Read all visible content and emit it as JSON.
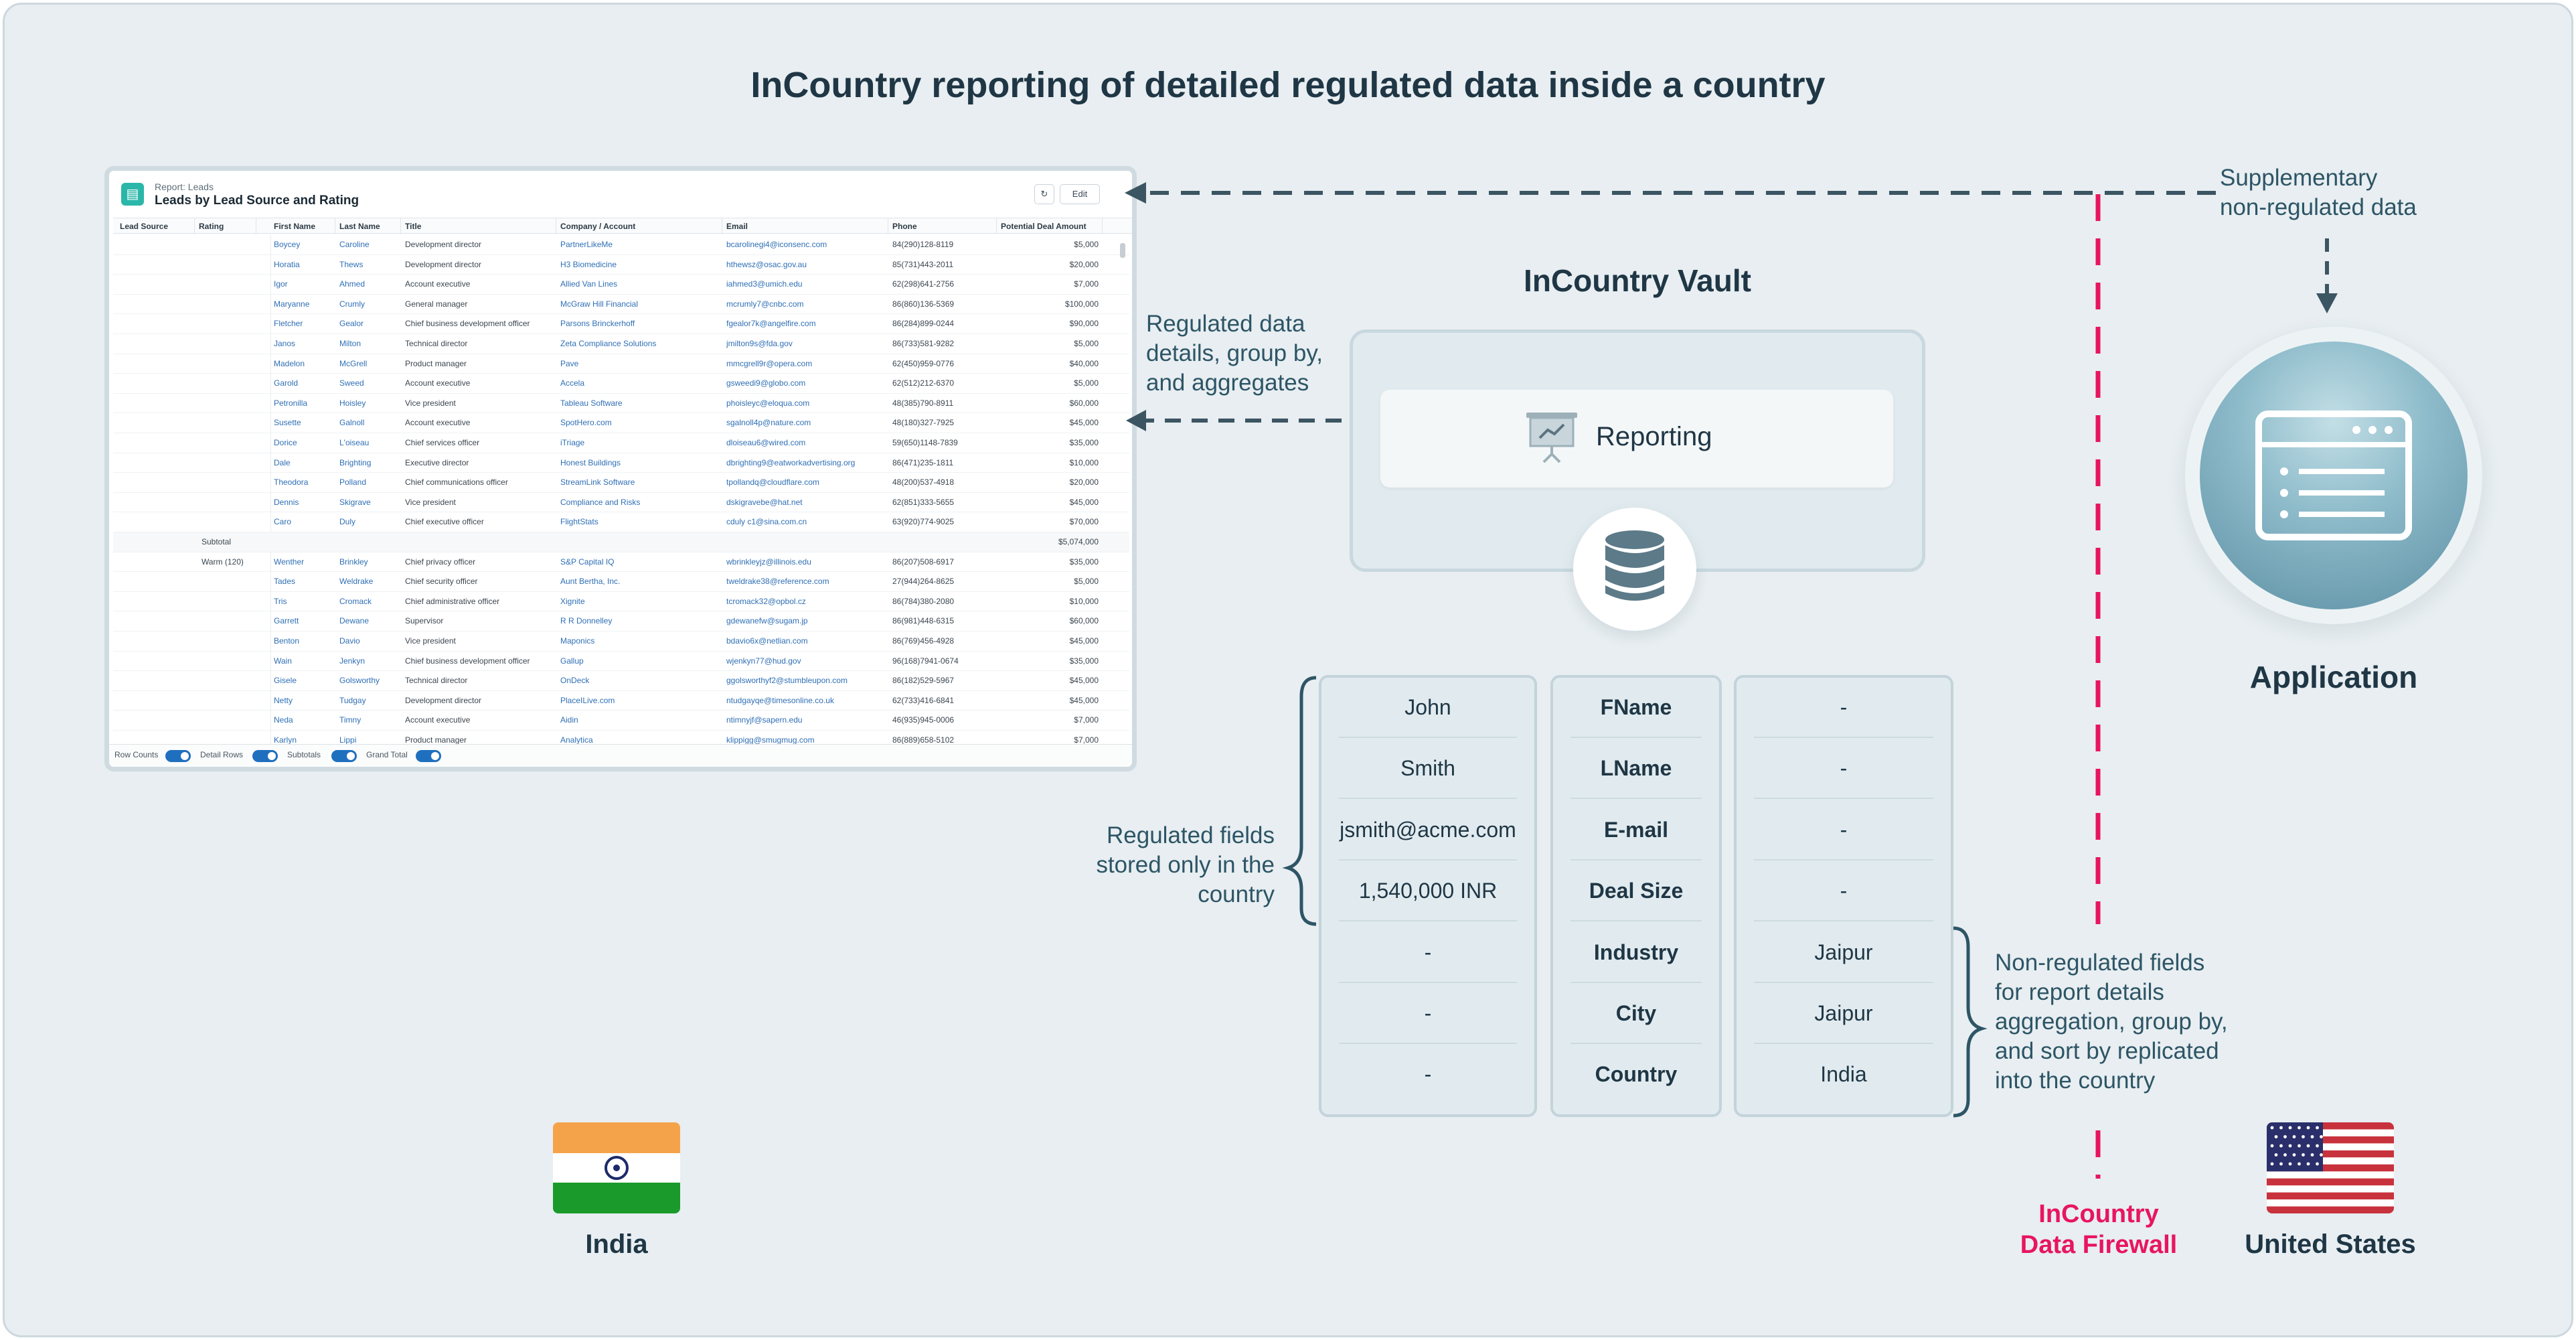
{
  "title": "InCountry reporting of detailed regulated data inside a country",
  "report": {
    "subtitle": "Report: Leads",
    "title": "Leads by Lead Source and Rating",
    "edit_label": "Edit",
    "refresh_icon": "refresh-icon",
    "columns": [
      "Lead Source",
      "Rating",
      "First Name",
      "Last Name",
      "Title",
      "Company / Account",
      "Email",
      "Phone",
      "Potential Deal Amount"
    ],
    "rows": [
      {
        "first": "Boycey",
        "last": "Caroline",
        "title": "Development director",
        "company": "PartnerLikeMe",
        "email": "bcarolinegi4@iconsenc.com",
        "phone": "84(290)128-8119",
        "amount": "$5,000"
      },
      {
        "first": "Horatia",
        "last": "Thews",
        "title": "Development director",
        "company": "H3 Biomedicine",
        "email": "hthewsz@osac.gov.au",
        "phone": "85(731)443-2011",
        "amount": "$20,000"
      },
      {
        "first": "Igor",
        "last": "Ahmed",
        "title": "Account executive",
        "company": "Allied Van Lines",
        "email": "iahmed3@umich.edu",
        "phone": "62(298)641-2756",
        "amount": "$7,000"
      },
      {
        "first": "Maryanne",
        "last": "Crumly",
        "title": "General manager",
        "company": "McGraw Hill Financial",
        "email": "mcrumly7@cnbc.com",
        "phone": "86(860)136-5369",
        "amount": "$100,000"
      },
      {
        "first": "Fletcher",
        "last": "Gealor",
        "title": "Chief business development officer",
        "company": "Parsons Brinckerhoff",
        "email": "fgealor7k@angelfire.com",
        "phone": "86(284)899-0244",
        "amount": "$90,000"
      },
      {
        "first": "Janos",
        "last": "Milton",
        "title": "Technical director",
        "company": "Zeta Compliance Solutions",
        "email": "jmilton9s@fda.gov",
        "phone": "86(733)581-9282",
        "amount": "$5,000"
      },
      {
        "first": "Madelon",
        "last": "McGrell",
        "title": "Product manager",
        "company": "Pave",
        "email": "mmcgrell9r@opera.com",
        "phone": "62(450)959-0776",
        "amount": "$40,000"
      },
      {
        "first": "Garold",
        "last": "Sweed",
        "title": "Account executive",
        "company": "Accela",
        "email": "gsweedi9@globo.com",
        "phone": "62(512)212-6370",
        "amount": "$5,000"
      },
      {
        "first": "Petronilla",
        "last": "Hoisley",
        "title": "Vice president",
        "company": "Tableau Software",
        "email": "phoisleyc@eloqua.com",
        "phone": "48(385)790-8911",
        "amount": "$60,000"
      },
      {
        "first": "Susette",
        "last": "Galnoll",
        "title": "Account executive",
        "company": "SpotHero.com",
        "email": "sgalnoll4p@nature.com",
        "phone": "48(180)327-7925",
        "amount": "$45,000"
      },
      {
        "first": "Dorice",
        "last": "L'oiseau",
        "title": "Chief services officer",
        "company": "iTriage",
        "email": "dloiseau6@wired.com",
        "phone": "59(650)1148-7839",
        "amount": "$35,000"
      },
      {
        "first": "Dale",
        "last": "Brighting",
        "title": "Executive director",
        "company": "Honest Buildings",
        "email": "dbrighting9@eatworkadvertising.org",
        "phone": "86(471)235-1811",
        "amount": "$10,000"
      },
      {
        "first": "Theodora",
        "last": "Polland",
        "title": "Chief communications officer",
        "company": "StreamLink Software",
        "email": "tpollandq@cloudflare.com",
        "phone": "48(200)537-4918",
        "amount": "$20,000"
      },
      {
        "first": "Dennis",
        "last": "Skigrave",
        "title": "Vice president",
        "company": "Compliance and Risks",
        "email": "dskigravebe@hat.net",
        "phone": "62(851)333-5655",
        "amount": "$45,000"
      },
      {
        "first": "Caro",
        "last": "Duly",
        "title": "Chief executive officer",
        "company": "FlightStats",
        "email": "cduly c1@sina.com.cn",
        "phone": "63(920)774-9025",
        "amount": "$70,000"
      },
      {
        "subtotal": "Subtotal",
        "amount": "$5,074,000"
      },
      {
        "group": "Warm (120)",
        "first": "Wenther",
        "last": "Brinkley",
        "title": "Chief privacy officer",
        "company": "S&P Capital IQ",
        "email": "wbrinkleyjz@illinois.edu",
        "phone": "86(207)508-6917",
        "amount": "$35,000"
      },
      {
        "first": "Tades",
        "last": "Weldrake",
        "title": "Chief security officer",
        "company": "Aunt Bertha, Inc.",
        "email": "tweldrake38@reference.com",
        "phone": "27(944)264-8625",
        "amount": "$5,000"
      },
      {
        "first": "Tris",
        "last": "Cromack",
        "title": "Chief administrative officer",
        "company": "Xignite",
        "email": "tcromack32@opbol.cz",
        "phone": "86(784)380-2080",
        "amount": "$10,000"
      },
      {
        "first": "Garrett",
        "last": "Dewane",
        "title": "Supervisor",
        "company": "R R Donnelley",
        "email": "gdewanefw@sugam.jp",
        "phone": "86(981)448-6315",
        "amount": "$60,000"
      },
      {
        "first": "Benton",
        "last": "Davio",
        "title": "Vice president",
        "company": "Maponics",
        "email": "bdavio6x@netlian.com",
        "phone": "86(769)456-4928",
        "amount": "$45,000"
      },
      {
        "first": "Wain",
        "last": "Jenkyn",
        "title": "Chief business development officer",
        "company": "Gallup",
        "email": "wjenkyn77@hud.gov",
        "phone": "96(168)7941-0674",
        "amount": "$35,000"
      },
      {
        "first": "Gisele",
        "last": "Golsworthy",
        "title": "Technical director",
        "company": "OnDeck",
        "email": "ggolsworthyf2@stumbleupon.com",
        "phone": "86(182)529-5967",
        "amount": "$45,000"
      },
      {
        "first": "Netty",
        "last": "Tudgay",
        "title": "Development director",
        "company": "PlaceILive.com",
        "email": "ntudgayqe@timesonline.co.uk",
        "phone": "62(733)416-6841",
        "amount": "$45,000"
      },
      {
        "first": "Neda",
        "last": "Timny",
        "title": "Account executive",
        "company": "Aidin",
        "email": "ntimnyjf@sapern.edu",
        "phone": "46(935)945-0006",
        "amount": "$7,000"
      },
      {
        "first": "Karlyn",
        "last": "Lippi",
        "title": "Product manager",
        "company": "Analytica",
        "email": "klippigg@smugmug.com",
        "phone": "86(889)658-5102",
        "amount": "$7,000"
      }
    ],
    "footer": {
      "row_counts": "Row Counts",
      "detail_rows": "Detail Rows",
      "subtotals": "Subtotals",
      "grand_total": "Grand Total"
    }
  },
  "arrows": {
    "regulated": "Regulated data\ndetails, group by,\nand aggregates",
    "supplementary": "Supplementary\nnon-regulated data"
  },
  "vault": {
    "title": "InCountry Vault",
    "reporting_label": "Reporting",
    "reporting_icon": "presentation-chart-icon",
    "db_icon": "database-icon"
  },
  "fields": {
    "col1": [
      "John",
      "Smith",
      "jsmith@acme.com",
      "1,540,000 INR",
      "-",
      "-",
      "-"
    ],
    "col2": [
      "FName",
      "LName",
      "E-mail",
      "Deal Size",
      "Industry",
      "City",
      "Country"
    ],
    "col3": [
      "-",
      "-",
      "-",
      "-",
      "Jaipur",
      "Jaipur",
      "India"
    ]
  },
  "labels": {
    "regulated_fields": "Regulated fields\nstored only in the\ncountry",
    "non_regulated_fields": "Non-regulated fields\nfor report details\naggregation, group by,\nand sort by replicated\ninto the country"
  },
  "application": {
    "label": "Application",
    "icon": "browser-window-icon"
  },
  "countries": {
    "left": "India",
    "right": "United States",
    "left_flag": "india-flag-icon",
    "right_flag": "us-flag-icon"
  },
  "firewall": {
    "label": "InCountry\nData Firewall",
    "color": "#e8155f"
  },
  "colors": {
    "background": "#e8eef1",
    "text_dark": "#1f3645",
    "text_teal": "#2d5566",
    "firewall": "#e8155f",
    "card_bg": "#e1ebef"
  }
}
